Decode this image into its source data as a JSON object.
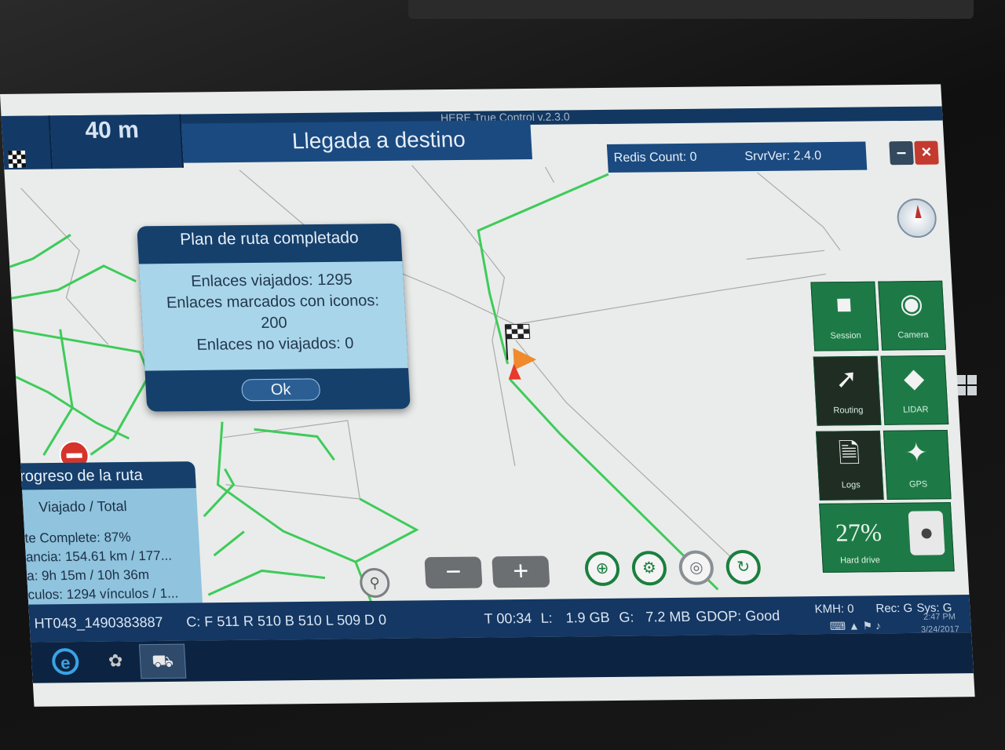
{
  "header": {
    "distance": "40 m",
    "message": "Llegada a destino",
    "app_title": "HERE True Control v.2.3.0"
  },
  "status": {
    "redis": "Redis Count: 0",
    "server": "SrvrVer: 2.4.0"
  },
  "dialog": {
    "title": "Plan de ruta completado",
    "line1": "Enlaces viajados: 1295",
    "line2": "Enlaces marcados con iconos:",
    "line3": "200",
    "line4": "Enlaces no viajados: 0",
    "ok_label": "Ok"
  },
  "progress": {
    "title": "rogreso de la ruta",
    "subtitle": "Viajado / Total",
    "row1": "te Complete: 87%",
    "row2": "ancia: 154.61 km / 177...",
    "row3": "a: 9h 15m / 10h 36m",
    "row4": "culos: 1294 vínculos / 1..."
  },
  "tiles": {
    "session": "Session",
    "camera": "Camera",
    "routing": "Routing",
    "lidar": "LIDAR",
    "logs": "Logs",
    "gps": "GPS",
    "hdd_percent": "27%",
    "hdd_label": "Hard drive"
  },
  "zoom": {
    "minus": "−",
    "plus": "+"
  },
  "bottom_bar": {
    "drive_id": "HT043_1490383887",
    "counts": "C: F 511 R 510 B 510 L 509 D 0",
    "time": "T 00:34",
    "l_label": "L:",
    "l_value": "1.9 GB",
    "g_label": "G:",
    "g_value": "7.2 MB",
    "gdop": "GDOP: Good",
    "kmh": "KMH: 0",
    "rec": "Rec: G",
    "sys": "Sys: G"
  },
  "tray": {
    "time": "2:47 PM",
    "date": "3/24/2017"
  },
  "colors": {
    "header_blue": "#133a66",
    "tile_green": "#1d7a46",
    "route_green": "#3ecb5a",
    "dialog_body": "#a8d5ea"
  }
}
